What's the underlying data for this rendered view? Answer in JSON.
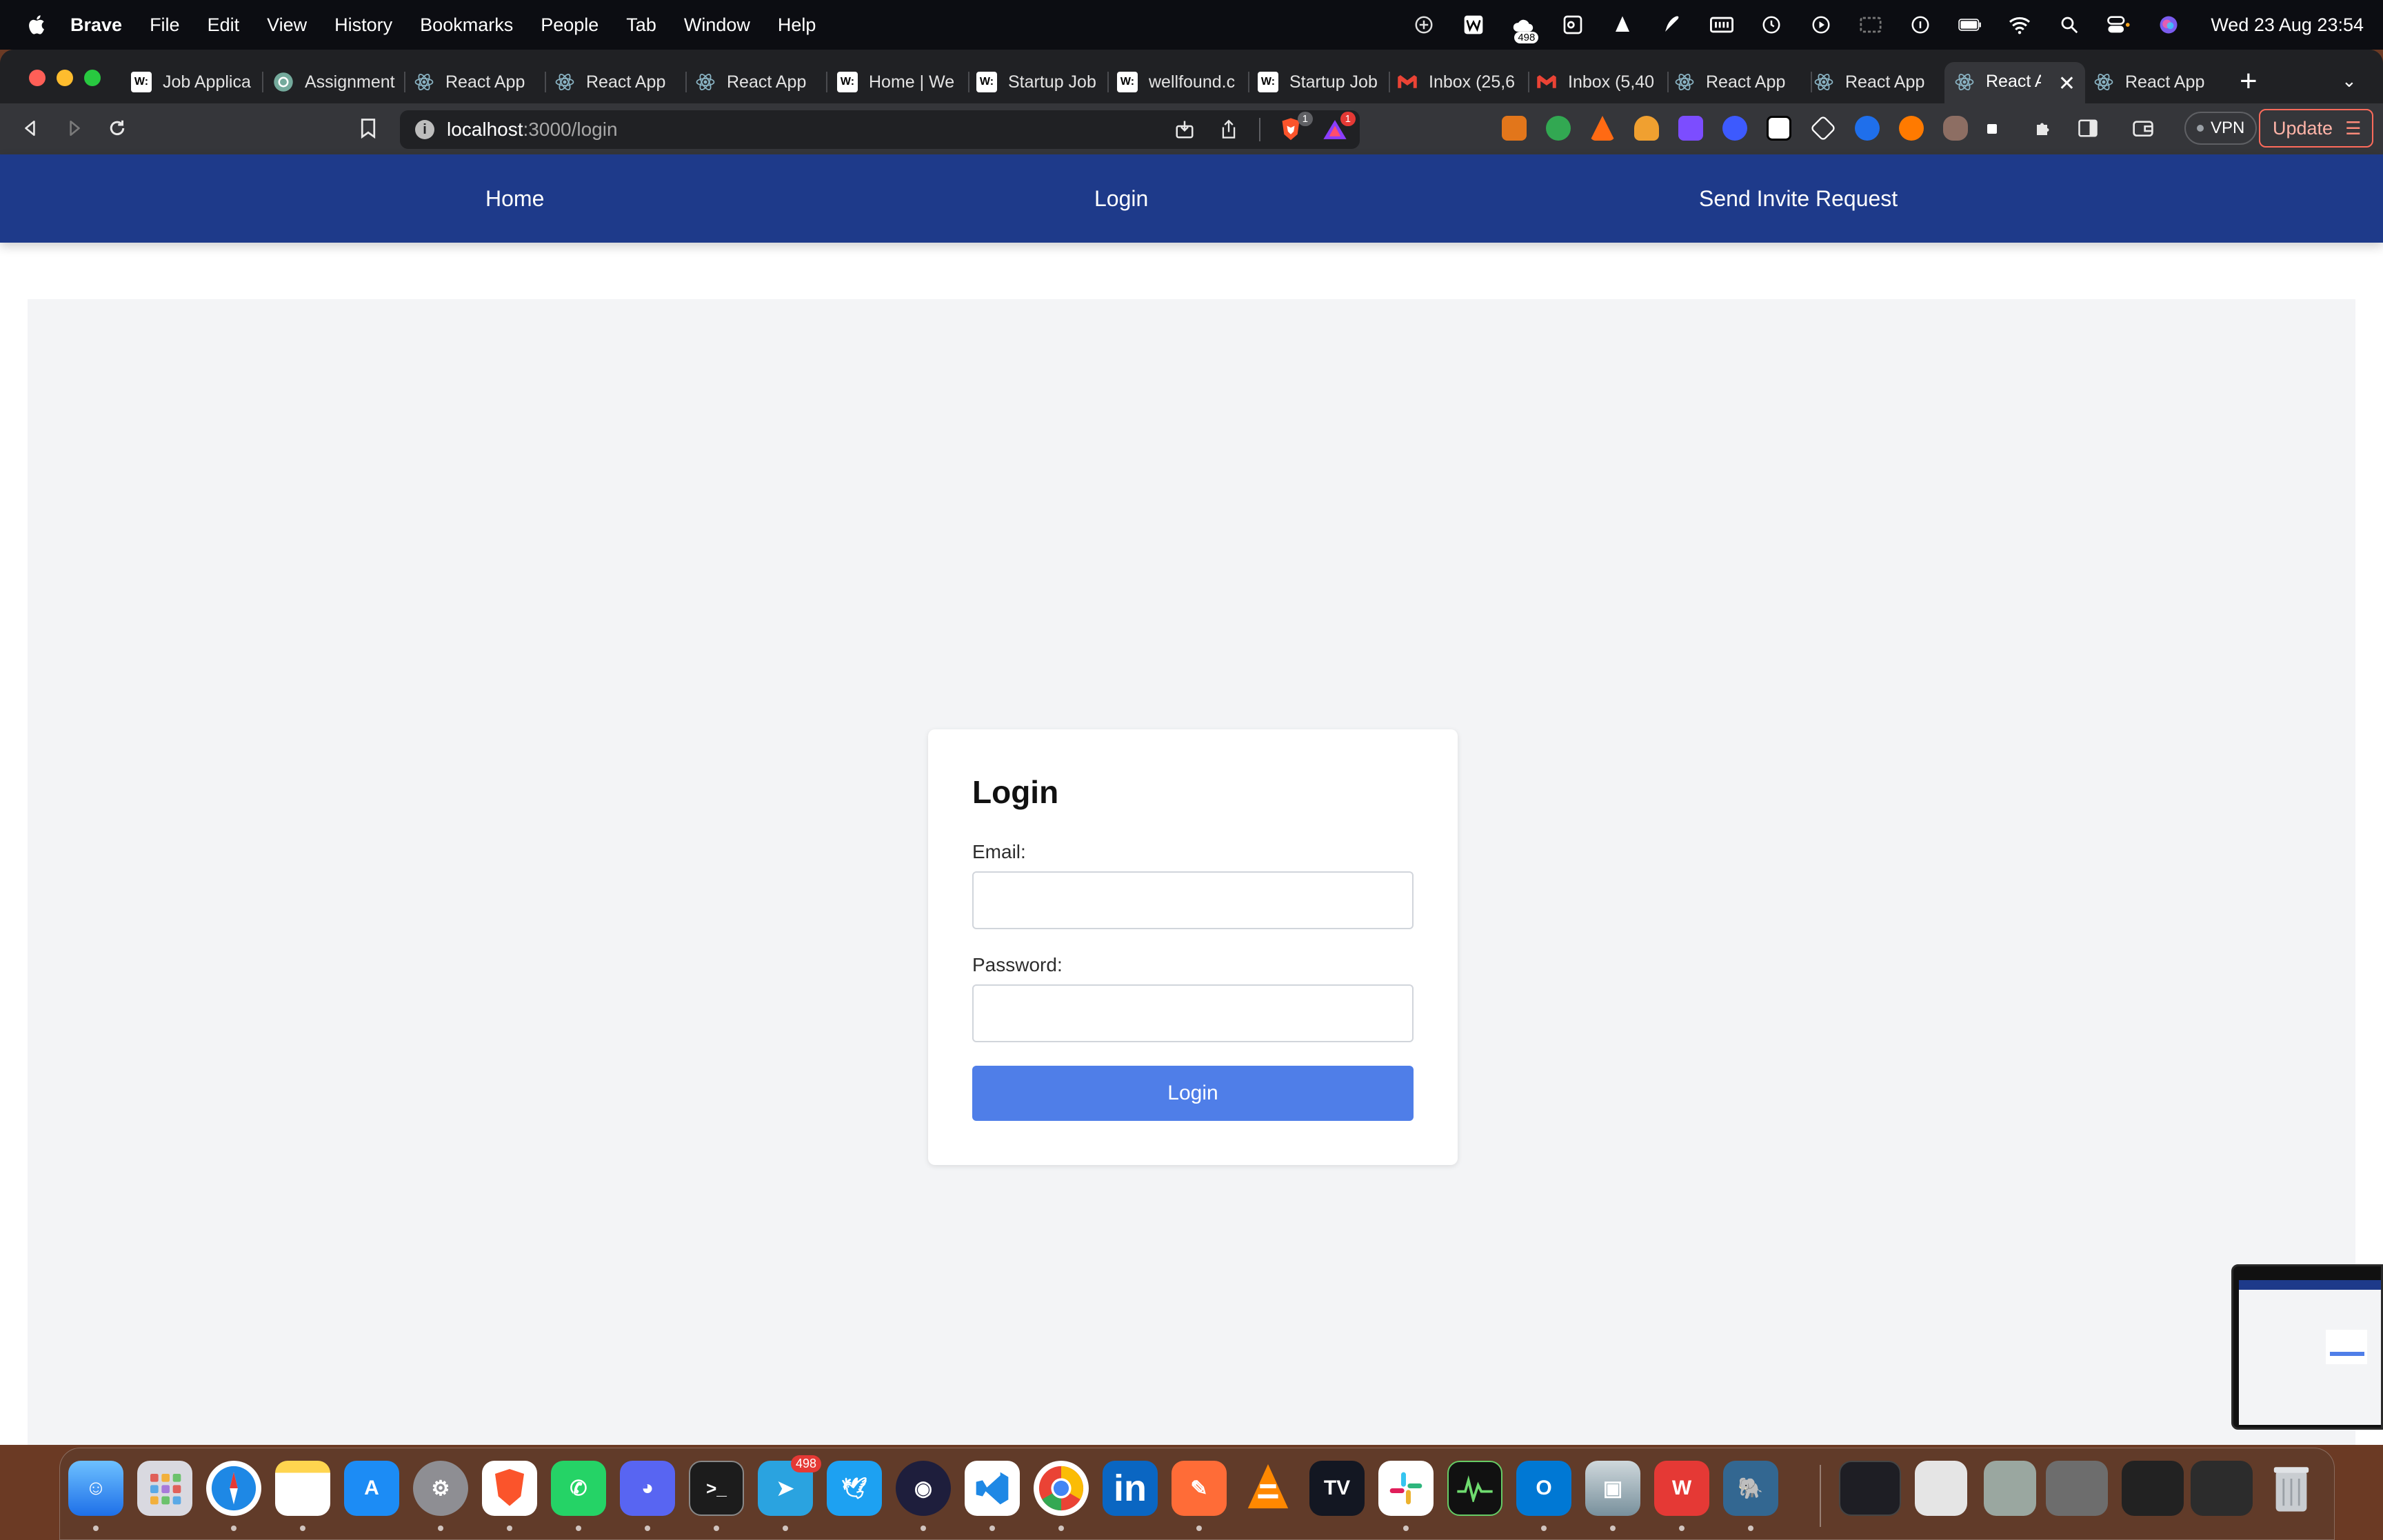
{
  "menubar": {
    "app_name": "Brave",
    "items": [
      "File",
      "Edit",
      "View",
      "History",
      "Bookmarks",
      "People",
      "Tab",
      "Window",
      "Help"
    ],
    "tray_badge": "498",
    "clock": "Wed 23 Aug  23:54"
  },
  "tabs": [
    {
      "label": "Job Applica",
      "favicon": "w-icon"
    },
    {
      "label": "Assignment",
      "favicon": "chatgpt-icon"
    },
    {
      "label": "React App",
      "favicon": "react-icon"
    },
    {
      "label": "React App",
      "favicon": "react-icon"
    },
    {
      "label": "React App",
      "favicon": "react-icon"
    },
    {
      "label": "Home | We",
      "favicon": "w-icon"
    },
    {
      "label": "Startup Job",
      "favicon": "w-icon"
    },
    {
      "label": "wellfound.c",
      "favicon": "w-icon"
    },
    {
      "label": "Startup Job",
      "favicon": "w-icon"
    },
    {
      "label": "Inbox (25,6",
      "favicon": "gmail-icon"
    },
    {
      "label": "Inbox (5,40",
      "favicon": "gmail-icon"
    },
    {
      "label": "React App",
      "favicon": "react-icon"
    },
    {
      "label": "React App",
      "favicon": "react-icon"
    },
    {
      "label": "React A",
      "favicon": "react-icon"
    },
    {
      "label": "React App",
      "favicon": "react-icon"
    }
  ],
  "address_bar": {
    "host": "localhost",
    "path": ":3000/login",
    "shields_badge": "1",
    "rewards_badge": "1"
  },
  "vpn_label": "VPN",
  "update_label": "Update",
  "nav": {
    "home": "Home",
    "login": "Login",
    "invite": "Send Invite Request"
  },
  "login_form": {
    "title": "Login",
    "email_label": "Email:",
    "email_value": "",
    "password_label": "Password:",
    "password_value": "",
    "submit_label": "Login"
  },
  "dock": {
    "telegram_badge": "498",
    "tradingview_label": "TV"
  },
  "colors": {
    "navbar": "#1e3a8a",
    "button": "#4f7ee8",
    "content_bg": "#f3f4f6"
  }
}
